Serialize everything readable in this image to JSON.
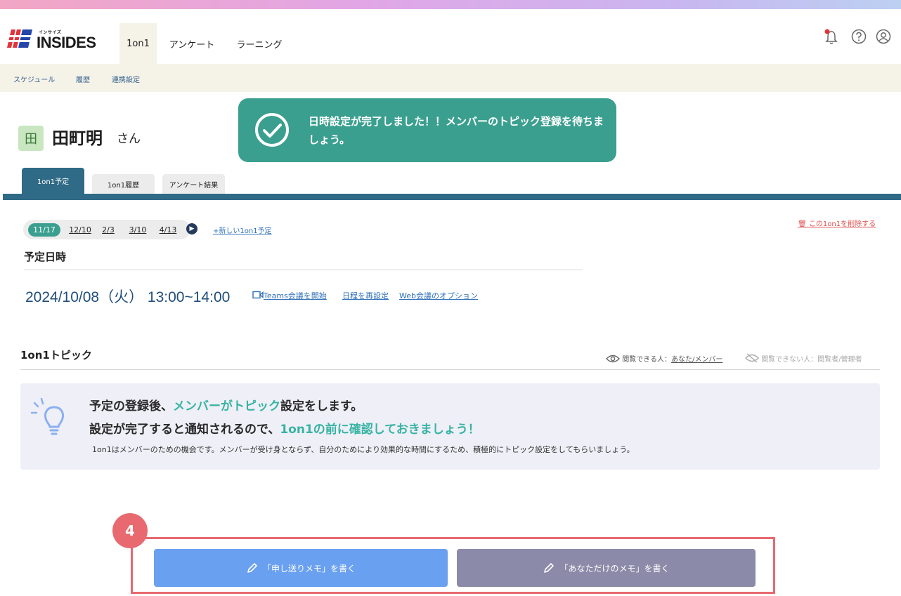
{
  "header": {
    "logo_small": "インサイズ",
    "logo_text": "INSIDES",
    "nav": [
      "1on1",
      "アンケート",
      "ラーニング"
    ]
  },
  "subnav": [
    "スケジュール",
    "履歴",
    "連携設定"
  ],
  "member": {
    "avatar": "田",
    "name": "田町明",
    "suffix": "さん"
  },
  "toast": {
    "message": "日時設定が完了しました！！メンバーのトピック登録を待ちましょう。"
  },
  "tabs": [
    "1on1予定",
    "1on1履歴",
    "アンケート結果"
  ],
  "dates": [
    "11/17",
    "12/10",
    "2/3",
    "3/10",
    "4/13"
  ],
  "new_schedule_link": "+新しい1on1予定",
  "delete_link": "この1on1を削除する",
  "schedule": {
    "title": "予定日時",
    "datetime": "2024/10/08（火） 13:00~14:00",
    "teams_link": "Teams会議を開始",
    "reschedule_link": "日程を再設定",
    "web_option_link": "Web会議のオプション"
  },
  "topic": {
    "title": "1on1トピック",
    "visible_label": "閲覧できる人：",
    "visible_value": "あなた/メンバー",
    "hidden_label": "閲覧できない人：閲覧者/管理者"
  },
  "info": {
    "line1_a": "予定の登録後、",
    "line1_hl": "メンバーがトピック",
    "line1_b": "設定をします。",
    "line2_a": "設定が完了すると通知されるので、",
    "line2_hl": "1on1の前に確認しておきましょう！",
    "sub": "1on1はメンバーのための機会です。メンバーが受け身とならず、自分のためにより効果的な時間にするため、積極的にトピック設定をしてもらいましょう。"
  },
  "step_number": "4",
  "buttons": {
    "memo_send": "「申し送りメモ」を書く",
    "memo_private": "「あなただけのメモ」を書く"
  },
  "colors": {
    "teal": "#3a9f8f",
    "navy": "#2f6a86",
    "highlight": "#e8696f",
    "blue_button": "#6aa0f0",
    "gray_button": "#8b8aa8"
  }
}
